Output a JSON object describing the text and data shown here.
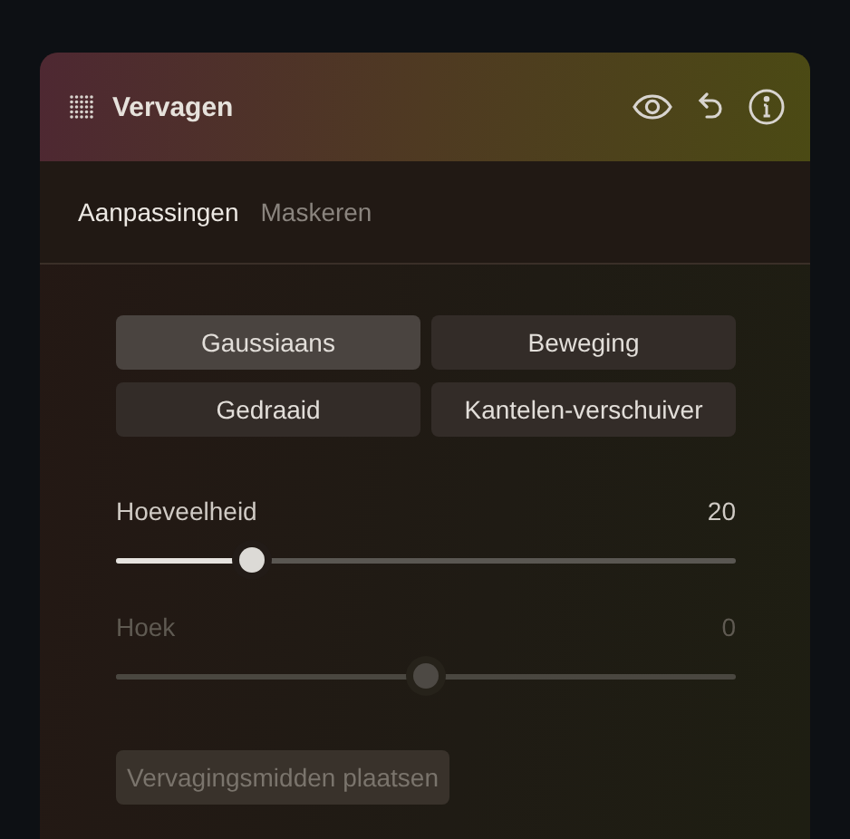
{
  "panel": {
    "title": "Vervagen",
    "tabs": [
      {
        "label": "Aanpassingen",
        "selected": true
      },
      {
        "label": "Maskeren",
        "selected": false
      }
    ],
    "blur_types": [
      {
        "label": "Gaussiaans",
        "selected": true
      },
      {
        "label": "Beweging",
        "selected": false
      },
      {
        "label": "Gedraaid",
        "selected": false
      },
      {
        "label": "Kantelen-verschuiver",
        "selected": false
      }
    ],
    "sliders": [
      {
        "label": "Hoeveelheid",
        "reading": "20",
        "level": 0.22,
        "disabled": false
      },
      {
        "label": "Hoek",
        "reading": "0",
        "level": 0.5,
        "disabled": true
      }
    ],
    "action_button": {
      "label": "Vervagingsmidden plaatsen",
      "disabled": true
    }
  }
}
